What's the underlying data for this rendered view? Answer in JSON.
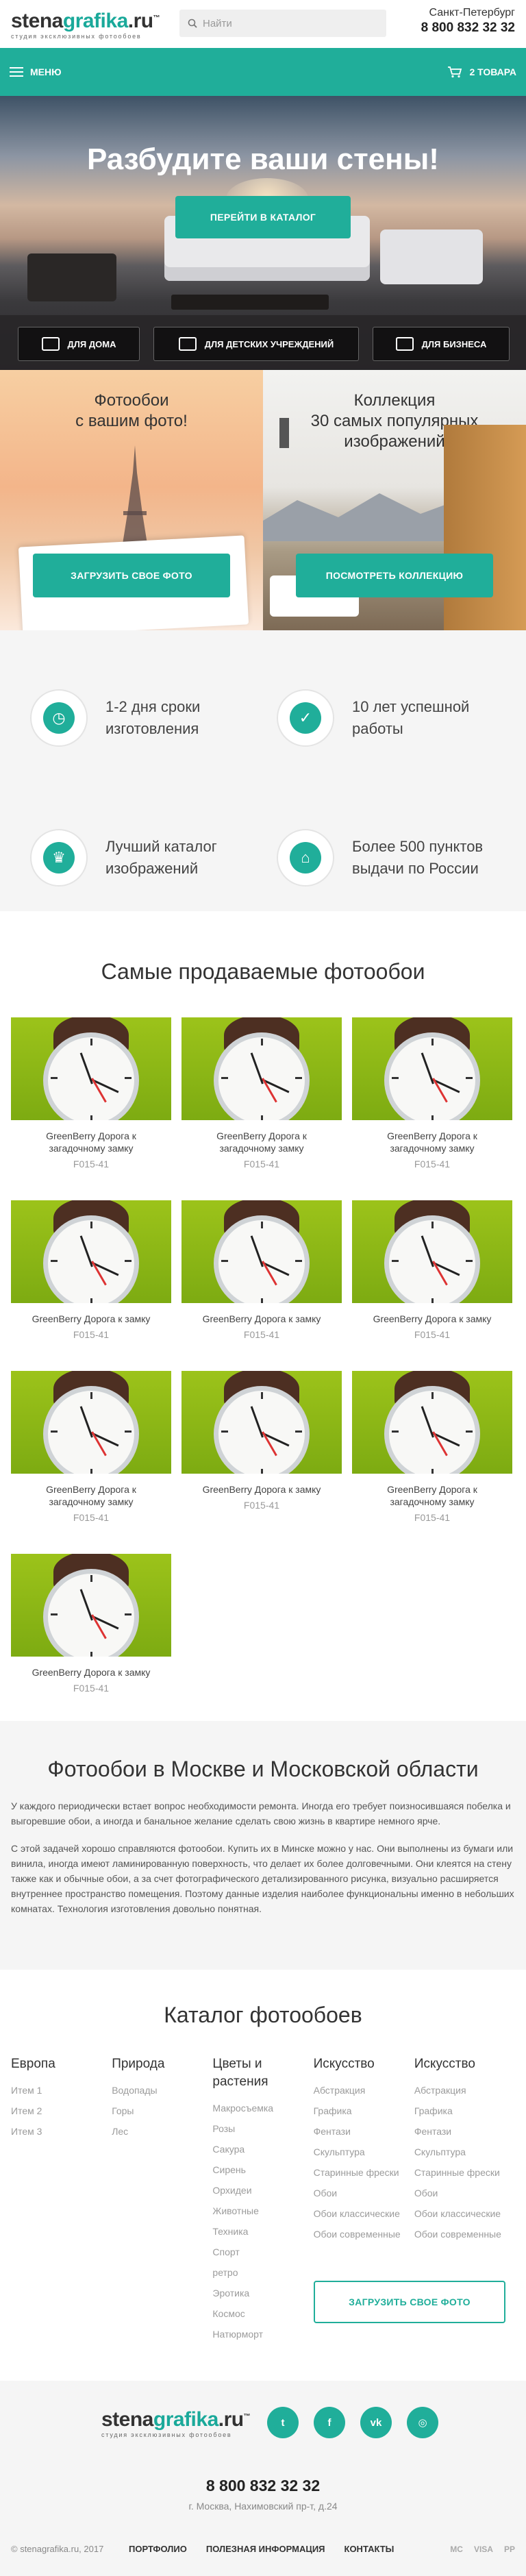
{
  "header": {
    "logo_main_prefix": "stena",
    "logo_main_accent": "grafika",
    "logo_main_suffix": ".ru",
    "logo_tm": "™",
    "logo_sub": "студия эксклюзивных фотообоев",
    "search_placeholder": "Найти",
    "city": "Санкт-Петербург",
    "phone": "8 800 832 32 32"
  },
  "nav": {
    "menu_label": "МЕНЮ",
    "cart_label": "2 ТОВАРА"
  },
  "hero": {
    "title": "Разбудите ваши стены!",
    "cta": "ПЕРЕЙТИ В КАТАЛОГ",
    "tabs": [
      "ДЛЯ ДОМА",
      "ДЛЯ ДЕТСКИХ УЧРЕЖДЕНИЙ",
      "ДЛЯ БИЗНЕСА"
    ]
  },
  "promo": {
    "left_title_1": "Фотообои",
    "left_title_2": "с вашим фото!",
    "left_btn": "ЗАГРУЗИТЬ СВОЕ ФОТО",
    "right_title_1": "Коллекция",
    "right_title_2": "30 самых популярных",
    "right_title_3": "изображений",
    "right_btn": "ПОСМОТРЕТЬ КОЛЛЕКЦИЮ"
  },
  "features": [
    {
      "icon": "clock-icon",
      "line1": "1-2 дня сроки",
      "line2": "изготовления"
    },
    {
      "icon": "check-badge-icon",
      "line1": "10 лет успешной",
      "line2": "работы"
    },
    {
      "icon": "trophy-icon",
      "line1": "Лучший каталог",
      "line2": "изображений"
    },
    {
      "icon": "map-pin-icon",
      "line1": "Более 500 пунктов",
      "line2": "выдачи по России"
    }
  ],
  "products": {
    "title": "Самые продаваемые фотообои",
    "items": [
      {
        "name": "GreenBerry Дорога к загадочному замку",
        "code": "F015-41"
      },
      {
        "name": "GreenBerry Дорога к загадочному замку",
        "code": "F015-41"
      },
      {
        "name": "GreenBerry Дорога к загадочному замку",
        "code": "F015-41"
      },
      {
        "name": "GreenBerry Дорога к замку",
        "code": "F015-41"
      },
      {
        "name": "GreenBerry Дорога к замку",
        "code": "F015-41"
      },
      {
        "name": "GreenBerry Дорога к замку",
        "code": "F015-41"
      },
      {
        "name": "GreenBerry Дорога к загадочному замку",
        "code": "F015-41"
      },
      {
        "name": "GreenBerry Дорога к замку",
        "code": "F015-41"
      },
      {
        "name": "GreenBerry Дорога к загадочному замку",
        "code": "F015-41"
      },
      {
        "name": "GreenBerry Дорога к замку",
        "code": "F015-41"
      }
    ]
  },
  "seo": {
    "title": "Фотообои в Москве и Московской области",
    "p1": "У каждого периодически встает вопрос необходимости ремонта. Иногда его требует поизносившаяся побелка и выгоревшие обои, а иногда и банальное желание сделать свою жизнь в квартире немного ярче.",
    "p2": "С этой задачей хорошо справляются фотообои. Купить их в Минске можно у нас. Они выполнены из бумаги или винила, иногда имеют ламинированную поверхность, что делает их более долговечными. Они клеятся на стену также как и обычные обои, а за счет фотографического детализированного рисунка, визуально расширяется внутреннее пространство помещения. Поэтому данные изделия наиболее функциональны именно в небольших комнатах. Технология изготовления довольно понятная."
  },
  "catalog": {
    "title": "Каталог фотообоев",
    "columns": [
      {
        "head": "Европа",
        "links": [
          "Итем 1",
          "Итем 2",
          "Итем 3"
        ]
      },
      {
        "head": "Природа",
        "links": [
          "Водопады",
          "Горы",
          "Лес"
        ]
      },
      {
        "head": "Цветы и растения",
        "links": [
          "Макросъемка",
          "Розы",
          "Сакура",
          "Сирень",
          "Орхидеи",
          "Животные",
          "Техника",
          "Спорт",
          "ретро",
          "Эротика",
          "Космос",
          "Натюрморт"
        ]
      },
      {
        "head": "Искусство",
        "links": [
          "Абстракция",
          "Графика",
          "Фентази",
          "Скульптура",
          "Старинные фрески",
          "Обои",
          "Обои классические",
          "Обои современные"
        ]
      },
      {
        "head": "Искусство",
        "links": [
          "Абстракция",
          "Графика",
          "Фентази",
          "Скульптура",
          "Старинные фрески",
          "Обои",
          "Обои классические",
          "Обои современные"
        ]
      }
    ],
    "upload_btn": "ЗАГРУЗИТЬ СВОЕ ФОТО"
  },
  "footer": {
    "socials": [
      "twitter-icon",
      "facebook-icon",
      "vk-icon",
      "instagram-icon"
    ],
    "social_glyphs": [
      "t",
      "f",
      "vk",
      "◎"
    ],
    "phone": "8 800 832 32 32",
    "address": "г. Москва, Нахимовский пр-т, д.24",
    "copyright": "© stenagrafika.ru, 2017",
    "links": [
      "ПОРТФОЛИО",
      "ПОЛЕЗНАЯ ИНФОРМАЦИЯ",
      "КОНТАКТЫ"
    ],
    "payments": [
      "MC",
      "VISA",
      "PP"
    ]
  }
}
